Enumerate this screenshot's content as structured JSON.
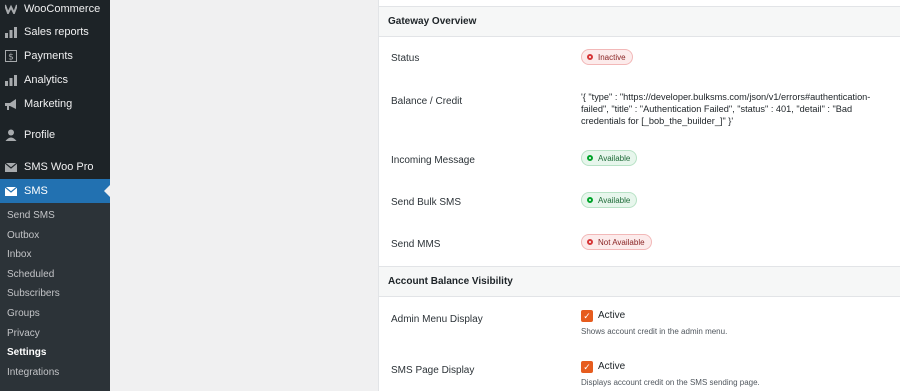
{
  "sidebar": {
    "menu": [
      {
        "label": "WooCommerce",
        "icon": "woocommerce-icon"
      },
      {
        "label": "Sales reports",
        "icon": "bar-chart-icon"
      },
      {
        "label": "Payments",
        "icon": "dollar-icon"
      },
      {
        "label": "Analytics",
        "icon": "bar-chart-icon"
      },
      {
        "label": "Marketing",
        "icon": "megaphone-icon"
      },
      {
        "label": "Profile",
        "icon": "user-icon"
      },
      {
        "label": "SMS Woo Pro",
        "icon": "envelope-icon"
      },
      {
        "label": "SMS",
        "icon": "envelope-icon"
      }
    ],
    "submenu": [
      "Send SMS",
      "Outbox",
      "Inbox",
      "Scheduled",
      "Subscribers",
      "Groups",
      "Privacy",
      "Settings",
      "Integrations"
    ]
  },
  "gateway": {
    "heading": "Gateway Overview",
    "rows": {
      "status": {
        "label": "Status",
        "value": "Inactive"
      },
      "balance": {
        "label": "Balance / Credit",
        "value": "'{ \"type\" : \"https://developer.bulksms.com/json/v1/errors#authentication-failed\", \"title\" : \"Authentication Failed\", \"status\" : 401, \"detail\" : \"Bad credentials for [_bob_the_builder_]\" }'"
      },
      "incoming": {
        "label": "Incoming Message",
        "value": "Available"
      },
      "bulk": {
        "label": "Send Bulk SMS",
        "value": "Available"
      },
      "mms": {
        "label": "Send MMS",
        "value": "Not Available"
      }
    }
  },
  "balance_visibility": {
    "heading": "Account Balance Visibility",
    "admin_menu": {
      "label": "Admin Menu Display",
      "checkbox_label": "Active",
      "checked": true,
      "description": "Shows account credit in the admin menu."
    },
    "sms_page": {
      "label": "SMS Page Display",
      "checkbox_label": "Active",
      "checked": true,
      "description": "Displays account credit on the SMS sending page."
    }
  },
  "colors": {
    "sidebar_bg": "#1d2327",
    "active_menu": "#2271b1",
    "checkbox": "#e65c1e",
    "inactive": "#d63638",
    "available": "#00a32a"
  }
}
